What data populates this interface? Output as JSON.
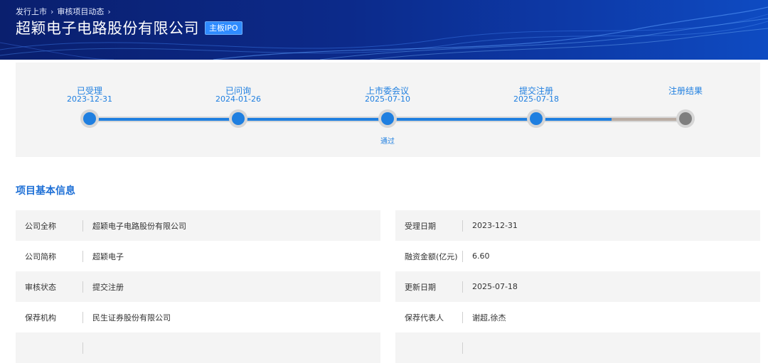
{
  "breadcrumb": {
    "item1": "发行上市",
    "item2": "审核项目动态"
  },
  "header": {
    "title": "超颖电子电路股份有限公司",
    "badge": "主板IPO"
  },
  "timeline": {
    "steps": [
      {
        "label": "已受理",
        "date": "2023-12-31",
        "status": "done"
      },
      {
        "label": "已问询",
        "date": "2024-01-26",
        "status": "done"
      },
      {
        "label": "上市委会议",
        "date": "2025-07-10",
        "status": "done",
        "note": "通过"
      },
      {
        "label": "提交注册",
        "date": "2025-07-18",
        "status": "done"
      },
      {
        "label": "注册结果",
        "date": "",
        "status": "pending"
      }
    ]
  },
  "section": {
    "title": "项目基本信息"
  },
  "info": {
    "left": [
      {
        "key": "公司全称",
        "value": "超颖电子电路股份有限公司"
      },
      {
        "key": "公司简称",
        "value": "超颖电子"
      },
      {
        "key": "审核状态",
        "value": "提交注册"
      },
      {
        "key": "保荐机构",
        "value": "民生证券股份有限公司"
      },
      {
        "key": "",
        "value": ""
      }
    ],
    "right": [
      {
        "key": "受理日期",
        "value": "2023-12-31"
      },
      {
        "key": "融资金额(亿元)",
        "value": "6.60"
      },
      {
        "key": "更新日期",
        "value": "2025-07-18"
      },
      {
        "key": "保荐代表人",
        "value": "谢超,徐杰"
      },
      {
        "key": "",
        "value": ""
      }
    ]
  },
  "colors": {
    "accent": "#1f7fe0",
    "banner": "#0c2a8a",
    "pending": "#7f7f7f"
  }
}
